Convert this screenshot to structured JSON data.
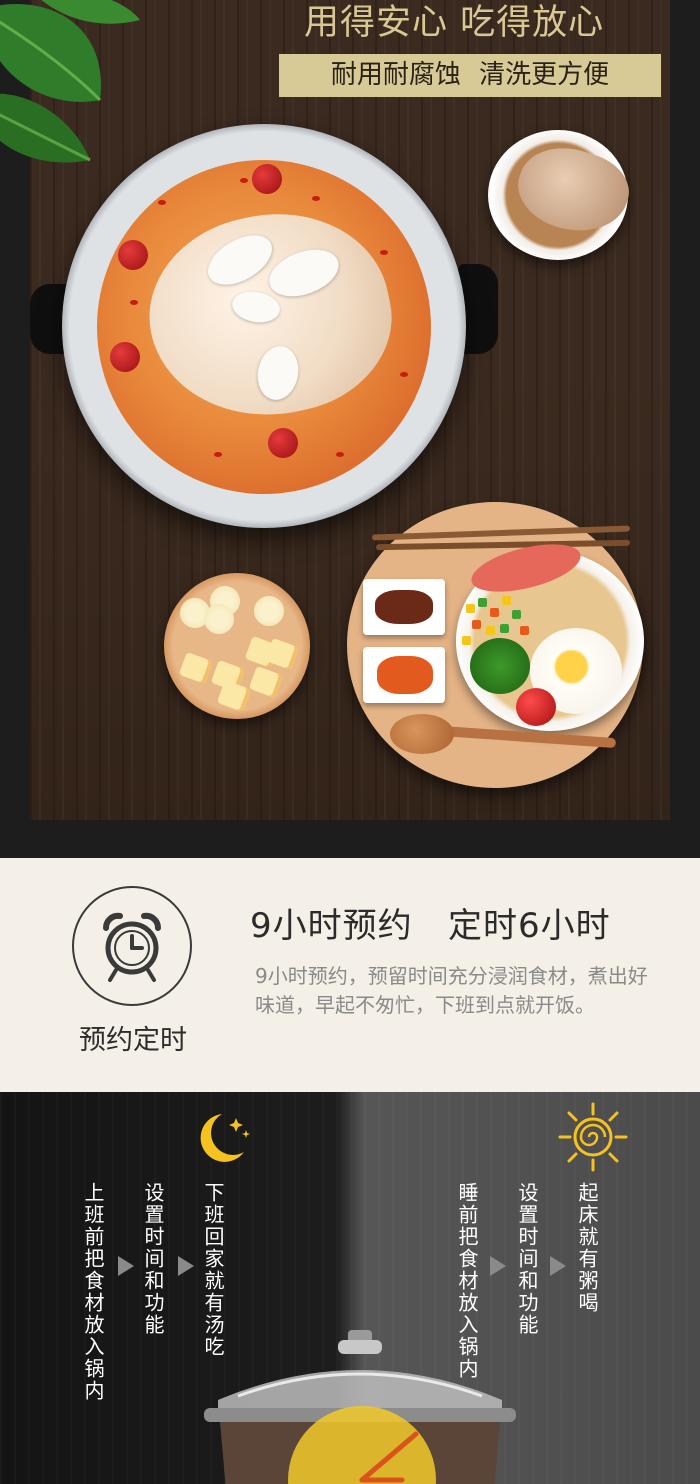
{
  "hero": {
    "headline": "用得安心 吃得放心",
    "subtitle": "耐用耐腐蚀  清洗更方便"
  },
  "feature": {
    "icon_label": "预约定时",
    "title": "9小时预约   定时6小时",
    "description": "9小时预约，预留时间充分浸润食材，煮出好味道，早起不匆忙，下班到点就开饭。"
  },
  "timeline": {
    "night": {
      "steps": [
        "上班前把食材放入锅内",
        "设置时间和功能",
        "下班回家就有汤吃"
      ]
    },
    "day": {
      "steps": [
        "睡前把食材放入锅内",
        "设置时间和功能",
        "起床就有粥喝"
      ]
    }
  },
  "colors": {
    "gold_text": "#d9c893",
    "gold_bar": "#d8ca97",
    "moon": "#f6c21f",
    "sun": "#f6c21f",
    "feature_bg": "#f4efe7"
  },
  "icons": [
    "leaf-icon",
    "alarm-clock-icon",
    "moon-icon",
    "sun-icon",
    "arrow-right-icon"
  ]
}
